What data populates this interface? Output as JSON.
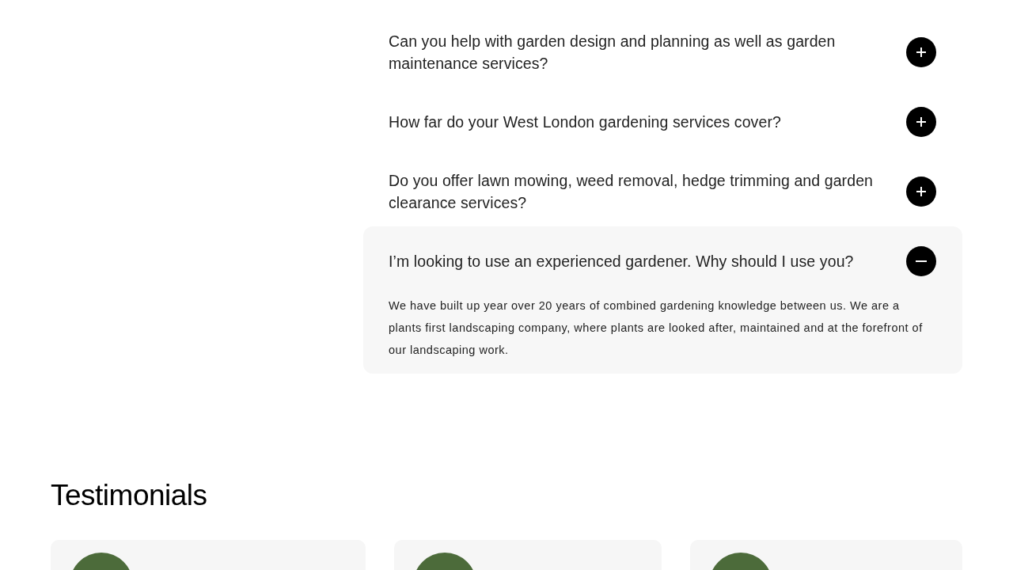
{
  "faq": [
    {
      "question": "Can you help with garden design and planning as well as garden maintenance services?",
      "expanded": false
    },
    {
      "question": "How far do your West London gardening services cover?",
      "expanded": false
    },
    {
      "question": "Do you offer lawn mowing, weed removal, hedge trimming and garden clearance services?",
      "expanded": false
    },
    {
      "question": "I’m looking to use an experienced gardener. Why should I use you?",
      "expanded": true,
      "answer": "We have built up year over 20 years of combined gardening knowledge between us. We are a plants first landscaping company, where plants are looked after, maintained and at the forefront of our landscaping work."
    }
  ],
  "testimonials": {
    "heading": "Testimonials",
    "cards": [
      {
        "kind": "photo"
      },
      {
        "kind": "photo"
      },
      {
        "kind": "photo"
      }
    ]
  }
}
